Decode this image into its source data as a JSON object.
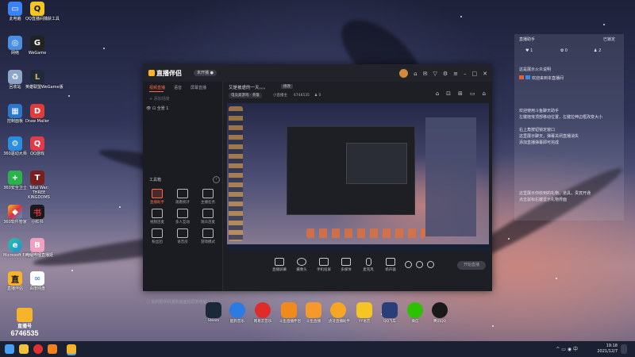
{
  "desktop_icons": [
    {
      "label": "此电脑",
      "icon": "computer-icon",
      "color": "#3b82f6",
      "glyph": "▭"
    },
    {
      "label": "QQ直播间捕获工具",
      "icon": "qq-tool-icon",
      "color": "#111111",
      "glyph": "Q"
    },
    {
      "label": "网络",
      "icon": "network-icon",
      "color": "#4a90e2",
      "glyph": "◎"
    },
    {
      "label": "WeGame",
      "icon": "wegame-icon",
      "color": "#222222",
      "glyph": "G"
    },
    {
      "label": "回收站",
      "icon": "recycle-bin-icon",
      "color": "#8da6c8",
      "glyph": "♻"
    },
    {
      "label": "英雄联盟WeGame版",
      "icon": "lol-icon",
      "color": "#1f2a3a",
      "glyph": "L"
    },
    {
      "label": "控制面板",
      "icon": "control-panel-icon",
      "color": "#2c78c8",
      "glyph": "▦"
    },
    {
      "label": "Draw Mailer",
      "icon": "draw-mailer-icon",
      "color": "#e23b3b",
      "glyph": "D"
    },
    {
      "label": "360驱动大师",
      "icon": "driver-master-icon",
      "color": "#2a8de0",
      "glyph": "⚙"
    },
    {
      "label": "QQ游戏",
      "icon": "qq-game-icon",
      "color": "#e03b4a",
      "glyph": "Q"
    },
    {
      "label": "360安全卫士",
      "icon": "360-security-icon",
      "color": "#2bb24c",
      "glyph": "+"
    },
    {
      "label": "Total War: THREE KINGDOMS",
      "icon": "three-kingdoms-icon",
      "color": "#7a1e1e",
      "glyph": "T"
    },
    {
      "label": "360软件管家",
      "icon": "360-software-icon",
      "color": "#3aa8e0",
      "glyph": "◆"
    },
    {
      "label": "小红书",
      "icon": "xiaohongshu-icon",
      "color": "#e0304a",
      "glyph": "书"
    },
    {
      "label": "Microsoft Edge",
      "icon": "edge-icon",
      "color": "#1d8fd6",
      "glyph": "e"
    },
    {
      "label": "哔哩哔哩直播姬",
      "icon": "bilibili-live-icon",
      "color": "#f0a0c0",
      "glyph": "B"
    },
    {
      "label": "直播伴侣",
      "icon": "live-companion-icon",
      "color": "#f5b42a",
      "glyph": "直"
    },
    {
      "label": "百度网盘",
      "icon": "baidu-netdisk-icon",
      "color": "#4c8df5",
      "glyph": "∞"
    }
  ],
  "overlay": {
    "brand": "直播号",
    "number": "6746535"
  },
  "app": {
    "logo": "直播伴侣",
    "status": "未开播 ●",
    "tabs": [
      {
        "label": "视频直播",
        "active": true
      },
      {
        "label": "语音",
        "active": false
      },
      {
        "label": "屏幕直播",
        "active": false
      }
    ],
    "add_scene": "+ 添加场景",
    "scene_name": "👁  ⊡  全景 1",
    "tools_title": "工具箱",
    "tools": [
      {
        "label": "直播助手",
        "hot": true
      },
      {
        "label": "观看统计",
        "hot": false
      },
      {
        "label": "主播任务",
        "hot": false
      },
      {
        "label": "视频连麦",
        "hot": false
      },
      {
        "label": "多人互动",
        "hot": false
      },
      {
        "label": "观众连麦",
        "hot": false
      },
      {
        "label": "粉丝团",
        "hot": false
      },
      {
        "label": "语音房",
        "hot": false
      },
      {
        "label": "游戏模式",
        "hot": false
      }
    ],
    "help_text": "ⓘ 如何把手机游戏画面投屏到电脑上?",
    "stream_title": "又是被虐的一天。。。",
    "edit_label": "修改",
    "category_chip": "电竞类游戏 · 英雄",
    "broadcaster": "小直播主",
    "room_id": "6746535",
    "viewers": "0",
    "bottom_buttons": [
      {
        "label": "直播屏幕",
        "icon": "screen-share-icon"
      },
      {
        "label": "摄像头",
        "icon": "camera-icon"
      },
      {
        "label": "手机投屏",
        "icon": "phone-cast-icon"
      },
      {
        "label": "多媒体",
        "icon": "media-icon"
      },
      {
        "label": "麦克风",
        "icon": "microphone-icon"
      },
      {
        "label": "扬声器",
        "icon": "speaker-icon"
      }
    ],
    "go_live": "开始直播"
  },
  "right_panel": {
    "header": "直播助手",
    "header_right": "已锁定",
    "counts": [
      "1",
      "0",
      "2"
    ],
    "lines": [
      "这是展示火炎说明",
      "欢迎来到本直播间",
      "",
      "欢迎使用斗鱼聊天助手",
      "左键拖曳顶部移动位置，左键拉伸边框改变大小",
      "右上角按钮锁定窗口",
      "这里展示聊天，弹幕关闭直播消失",
      "添加直播弹幕即可完成",
      "",
      "这里展示你收到的礼物，道具，贵宾开通",
      "点击鼠标右键显示礼物界面"
    ]
  },
  "dock": [
    {
      "label": "Steam",
      "color": "#1b2838"
    },
    {
      "label": "酷狗音乐",
      "color": "#2a7be4"
    },
    {
      "label": "网易云音乐",
      "color": "#e02b2b"
    },
    {
      "label": "斗鱼直播伴侣",
      "color": "#f08a1a"
    },
    {
      "label": "斗鱼直播",
      "color": "#f59a2a"
    },
    {
      "label": "虎牙直播助手",
      "color": "#f5a623"
    },
    {
      "label": "YY语音",
      "color": "#f5c623"
    },
    {
      "label": "QQ飞车",
      "color": "#2a3e7a"
    },
    {
      "label": "微信",
      "color": "#2dc100"
    },
    {
      "label": "腾讯QQ",
      "color": "#1a1a1a"
    }
  ],
  "taskbar": {
    "time": "19:18",
    "date": "2021/12/7",
    "tray": "^  ▭  ◉  中"
  }
}
